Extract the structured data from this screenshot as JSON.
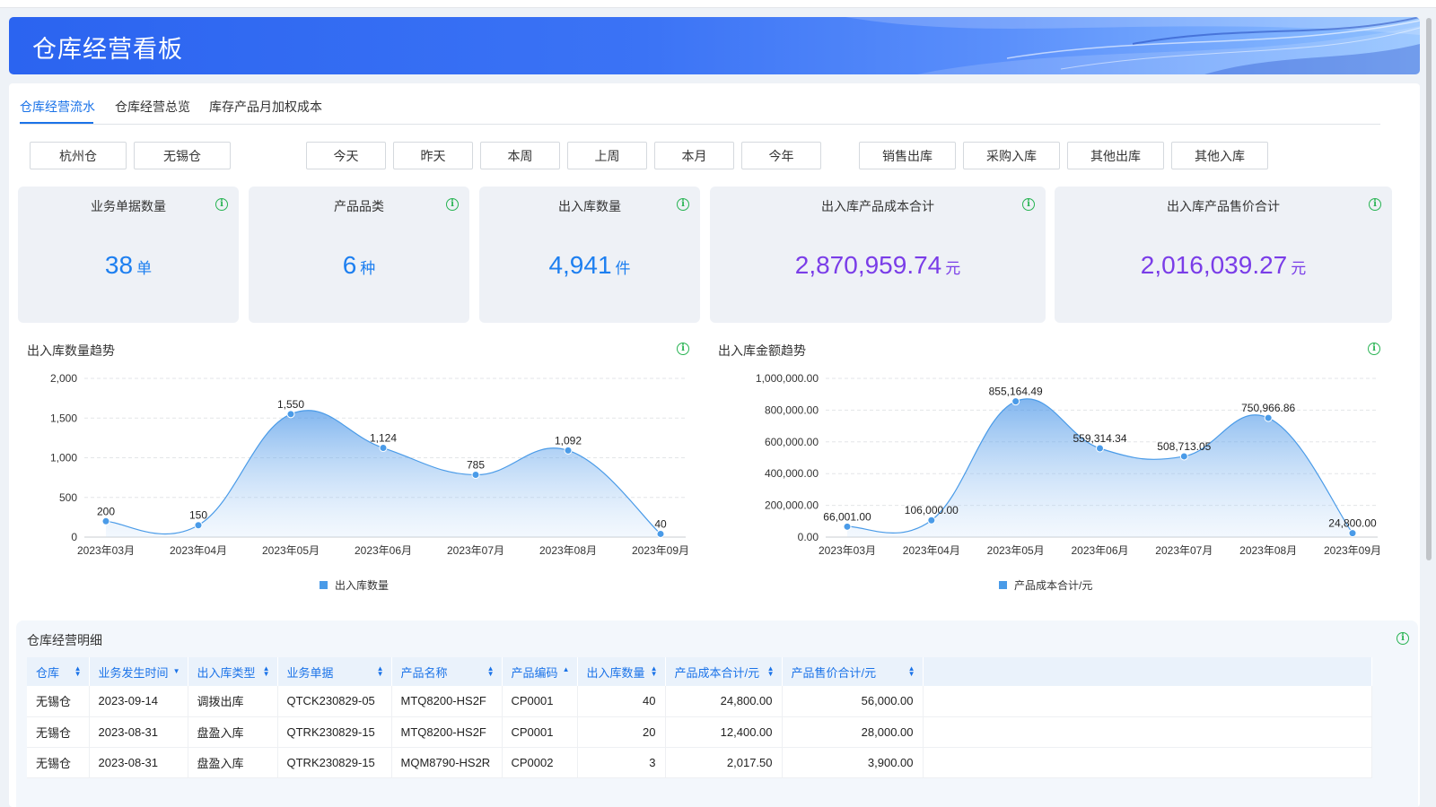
{
  "banner": {
    "title": "仓库经营看板"
  },
  "tabs": [
    {
      "label": "仓库经营流水"
    },
    {
      "label": "仓库经营总览"
    },
    {
      "label": "库存产品月加权成本"
    }
  ],
  "filters": {
    "warehouses": [
      "杭州仓",
      "无锡仓"
    ],
    "periods": [
      "今天",
      "昨天",
      "本周",
      "上周",
      "本月",
      "今年"
    ],
    "types": [
      "销售出库",
      "采购入库",
      "其他出库",
      "其他入库"
    ]
  },
  "kpis": [
    {
      "title": "业务单据数量",
      "value": "38",
      "unit": "单"
    },
    {
      "title": "产品品类",
      "value": "6",
      "unit": "种"
    },
    {
      "title": "出入库数量",
      "value": "4,941",
      "unit": "件"
    },
    {
      "title": "出入库产品成本合计",
      "value": "2,870,959.74",
      "unit": "元"
    },
    {
      "title": "出入库产品售价合计",
      "value": "2,016,039.27",
      "unit": "元"
    }
  ],
  "charts": {
    "qty_title": "出入库数量趋势",
    "amount_title": "出入库金额趋势"
  },
  "chart_data": [
    {
      "type": "area",
      "title": "出入库数量趋势",
      "categories": [
        "2023年03月",
        "2023年04月",
        "2023年05月",
        "2023年06月",
        "2023年07月",
        "2023年08月",
        "2023年09月"
      ],
      "series": [
        {
          "name": "出入库数量",
          "values": [
            200,
            150,
            1550,
            1124,
            785,
            1092,
            40
          ]
        }
      ],
      "data_labels": [
        "200",
        "150",
        "1,550",
        "1,124",
        "785",
        "1,092",
        "40"
      ],
      "ylim": [
        0,
        2000
      ],
      "yticks": [
        0,
        500,
        1000,
        1500,
        2000
      ],
      "ytick_labels": [
        "0",
        "500",
        "1,000",
        "1,500",
        "2,000"
      ],
      "grid": true,
      "legend": "bottom-center",
      "color": "#4a9be8"
    },
    {
      "type": "area",
      "title": "出入库金额趋势",
      "categories": [
        "2023年03月",
        "2023年04月",
        "2023年05月",
        "2023年06月",
        "2023年07月",
        "2023年08月",
        "2023年09月"
      ],
      "series": [
        {
          "name": "产品成本合计/元",
          "values": [
            66001.0,
            106000.0,
            855164.49,
            559314.34,
            508713.05,
            750966.86,
            24800.0
          ]
        }
      ],
      "data_labels": [
        "66,001.00",
        "106,000.00",
        "855,164.49",
        "559,314.34",
        "508,713.05",
        "750,966.86",
        "24,800.00"
      ],
      "ylim": [
        0,
        1000000
      ],
      "yticks": [
        0,
        200000,
        400000,
        600000,
        800000,
        1000000
      ],
      "ytick_labels": [
        "0.00",
        "200,000.00",
        "400,000.00",
        "600,000.00",
        "800,000.00",
        "1,000,000.00"
      ],
      "grid": true,
      "legend": "bottom-center",
      "color": "#4a9be8"
    }
  ],
  "detail": {
    "title": "仓库经营明细",
    "columns": [
      "仓库",
      "业务发生时间",
      "出入库类型",
      "业务单据",
      "产品名称",
      "产品编码",
      "出入库数量",
      "产品成本合计/元",
      "产品售价合计/元"
    ],
    "rows": [
      [
        "无锡仓",
        "2023-09-14",
        "调拨出库",
        "QTCK230829-05",
        "MTQ8200-HS2F",
        "CP0001",
        "40",
        "24,800.00",
        "56,000.00"
      ],
      [
        "无锡仓",
        "2023-08-31",
        "盘盈入库",
        "QTRK230829-15",
        "MTQ8200-HS2F",
        "CP0001",
        "20",
        "12,400.00",
        "28,000.00"
      ],
      [
        "无锡仓",
        "2023-08-31",
        "盘盈入库",
        "QTRK230829-15",
        "MQM8790-HS2R",
        "CP0002",
        "3",
        "2,017.50",
        "3,900.00"
      ]
    ]
  },
  "colors": {
    "accent": "#1b73e8",
    "kpi_blue": "#1d7ff0",
    "kpi_purple": "#7a3de8",
    "info_green": "#27b352"
  }
}
